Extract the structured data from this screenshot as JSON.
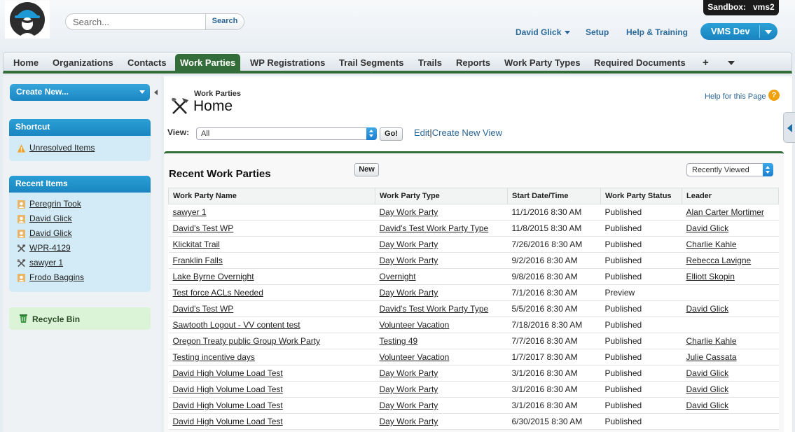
{
  "header": {
    "search_placeholder": "Search...",
    "search_button": "Search",
    "sandbox_label": "Sandbox:",
    "sandbox_name": "vms2",
    "user_name": "David Glick",
    "setup": "Setup",
    "help_training": "Help & Training",
    "app_name": "VMS Dev"
  },
  "tabs": [
    {
      "label": "Home"
    },
    {
      "label": "Organizations"
    },
    {
      "label": "Contacts"
    },
    {
      "label": "Work Parties",
      "active": true
    },
    {
      "label": "WP Registrations"
    },
    {
      "label": "Trail Segments"
    },
    {
      "label": "Trails"
    },
    {
      "label": "Reports"
    },
    {
      "label": "Work Party Types"
    },
    {
      "label": "Required Documents"
    },
    {
      "label": "+"
    }
  ],
  "sidebar": {
    "create_new": "Create New...",
    "shortcut_title": "Shortcut",
    "shortcut_item": "Unresolved Items",
    "recent_title": "Recent Items",
    "recent_items": [
      {
        "label": "Peregrin Took",
        "icon": "contact-icon"
      },
      {
        "label": "David Glick",
        "icon": "contact-icon"
      },
      {
        "label": "David Glick",
        "icon": "contact-icon"
      },
      {
        "label": "WPR-4129",
        "icon": "tools-icon"
      },
      {
        "label": "sawyer 1",
        "icon": "tools-icon"
      },
      {
        "label": "Frodo Baggins",
        "icon": "contact-icon"
      }
    ],
    "recycle_bin": "Recycle Bin"
  },
  "main": {
    "breadcrumb": "Work Parties",
    "title": "Home",
    "help_link": "Help for this Page",
    "view_label": "View:",
    "view_value": "All",
    "go_button": "Go!",
    "edit_link": "Edit",
    "separator": "|",
    "create_view_link": "Create New View",
    "section_title": "Recent Work Parties",
    "new_button": "New",
    "sort_value": "Recently Viewed",
    "columns": [
      "Work Party Name",
      "Work Party Type",
      "Start Date/Time",
      "Work Party Status",
      "Leader"
    ],
    "rows": [
      [
        "sawyer 1",
        "Day Work Party",
        "11/1/2016 8:30 AM",
        "Published",
        "Alan Carter Mortimer"
      ],
      [
        "David's Test WP",
        "David's Test Work Party Type",
        "11/8/2015 8:30 AM",
        "Published",
        "David Glick"
      ],
      [
        "Klickitat Trail",
        "Day Work Party",
        "7/26/2016 8:30 AM",
        "Published",
        "Charlie Kahle"
      ],
      [
        "Franklin Falls",
        "Day Work Party",
        "9/2/2016 8:30 AM",
        "Published",
        "Rebecca Lavigne"
      ],
      [
        "Lake Byrne Overnight",
        "Overnight",
        "9/8/2016 8:30 AM",
        "Published",
        "Elliott Skopin"
      ],
      [
        "Test force ACLs Needed",
        "Day Work Party",
        "7/1/2016 8:30 AM",
        "Preview",
        ""
      ],
      [
        "David's Test WP",
        "David's Test Work Party Type",
        "5/5/2016 8:30 AM",
        "Published",
        "David Glick"
      ],
      [
        "Sawtooth Logout - VV content test",
        "Volunteer Vacation",
        "7/18/2016 8:30 AM",
        "Published",
        ""
      ],
      [
        "Oregon Treaty public Group Work Party",
        "Testing 49",
        "7/7/2016 8:30 AM",
        "Published",
        "Charlie Kahle"
      ],
      [
        "Testing incentive days",
        "Volunteer Vacation",
        "1/7/2017 8:30 AM",
        "Published",
        "Julie Cassata"
      ],
      [
        "David High Volume Load Test",
        "Day Work Party",
        "3/1/2016 8:30 AM",
        "Published",
        "David Glick"
      ],
      [
        "David High Volume Load Test",
        "Day Work Party",
        "3/1/2016 8:30 AM",
        "Published",
        "David Glick"
      ],
      [
        "David High Volume Load Test",
        "Day Work Party",
        "3/1/2016 8:30 AM",
        "Published",
        "David Glick"
      ],
      [
        "David High Volume Load Test",
        "Day Work Party",
        "6/30/2015 8:30 AM",
        "Published",
        ""
      ]
    ]
  },
  "colors": {
    "tab_green": "#336e3a",
    "sidebar_blue": "#1a86c1",
    "link_blue": "#2a6496"
  }
}
